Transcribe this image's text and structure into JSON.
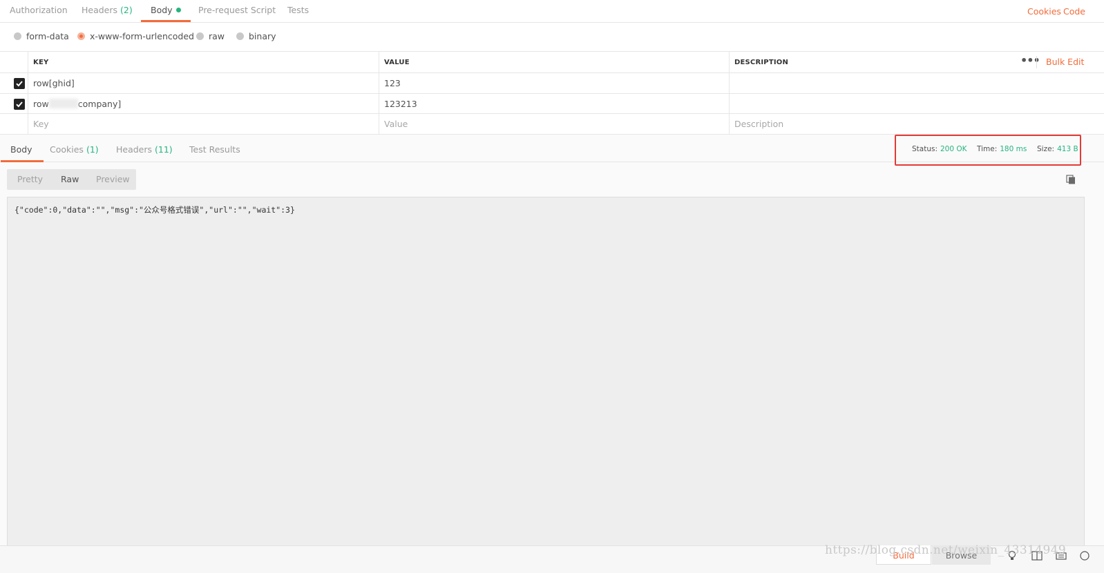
{
  "request_tabs": [
    {
      "label": "Authorization",
      "count": ""
    },
    {
      "label": "Headers",
      "count": "(2)"
    },
    {
      "label": "Body",
      "count": ""
    },
    {
      "label": "Pre-request Script",
      "count": ""
    },
    {
      "label": "Tests",
      "count": ""
    }
  ],
  "top_links": {
    "cookies": "Cookies",
    "code": "Code"
  },
  "body_types": [
    "form-data",
    "x-www-form-urlencoded",
    "raw",
    "binary"
  ],
  "body_type_selected": "x-www-form-urlencoded",
  "table": {
    "headers": {
      "key": "KEY",
      "value": "VALUE",
      "description": "DESCRIPTION"
    },
    "more": "•••",
    "bulk_edit": "Bulk Edit",
    "rows": [
      {
        "checked": true,
        "key": "row[ghid]",
        "value": "123",
        "description": ""
      },
      {
        "checked": true,
        "key_prefix": "row",
        "key_suffix": "company]",
        "value": "123213",
        "description": ""
      }
    ],
    "placeholders": {
      "key": "Key",
      "value": "Value",
      "description": "Description"
    }
  },
  "response_tabs": [
    {
      "label": "Body",
      "count": ""
    },
    {
      "label": "Cookies",
      "count": "(1)"
    },
    {
      "label": "Headers",
      "count": "(11)"
    },
    {
      "label": "Test Results",
      "count": ""
    }
  ],
  "status": {
    "status_label": "Status:",
    "status_value": "200 OK",
    "time_label": "Time:",
    "time_value": "180 ms",
    "size_label": "Size:",
    "size_value": "413 B"
  },
  "format_tabs": [
    "Pretty",
    "Raw",
    "Preview"
  ],
  "format_selected": "Raw",
  "response_body": "{\"code\":0,\"data\":\"\",\"msg\":\"公众号格式错误\",\"url\":\"\",\"wait\":3}",
  "bottom": {
    "build": "Build",
    "browse": "Browse"
  },
  "watermark": "https://blog.csdn.net/weixin_43314949",
  "colors": {
    "accent": "#f26b3a",
    "success": "#26b47f",
    "highlight_box": "#e53935"
  }
}
